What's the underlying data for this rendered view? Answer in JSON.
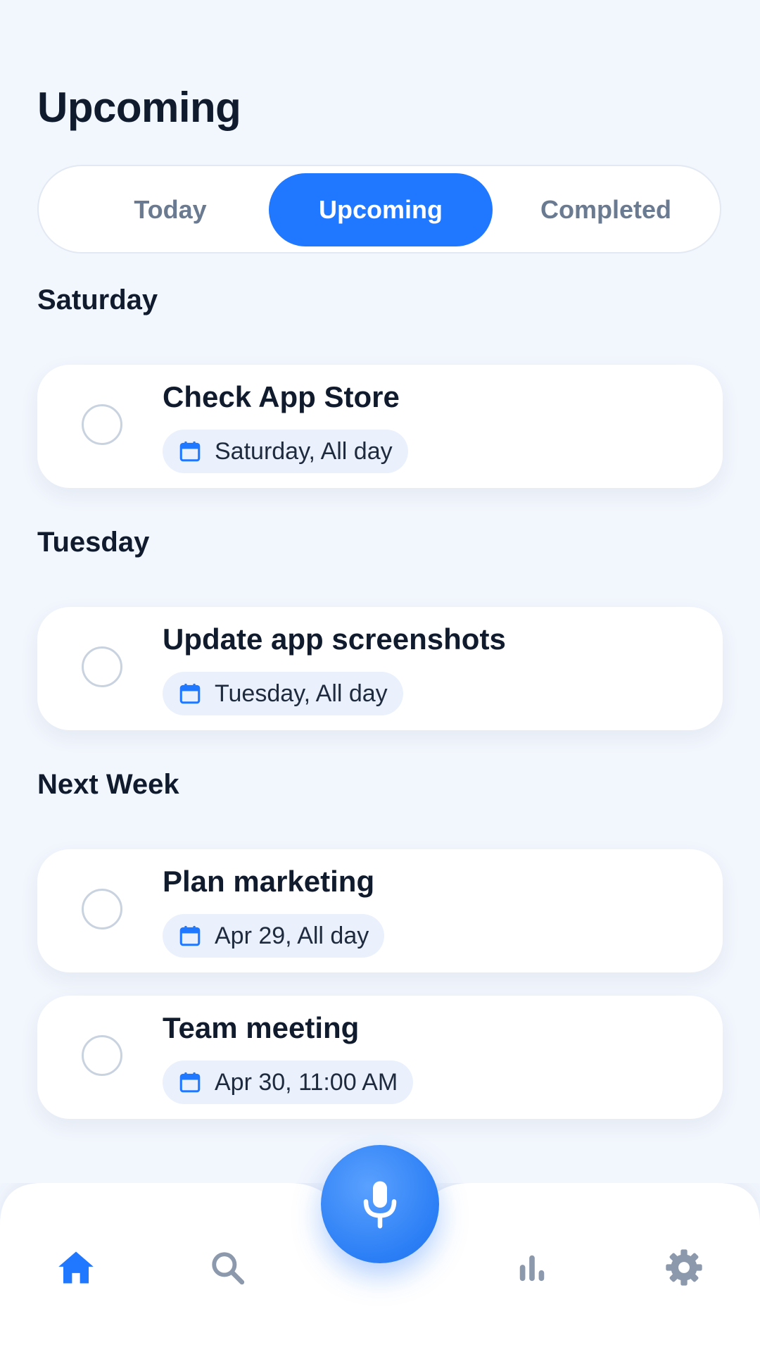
{
  "header": {
    "title": "Upcoming"
  },
  "tabs": [
    {
      "label": "Today",
      "active": false
    },
    {
      "label": "Upcoming",
      "active": true
    },
    {
      "label": "Completed",
      "active": false
    }
  ],
  "sections": [
    {
      "heading": "Saturday",
      "tasks": [
        {
          "title": "Check App Store",
          "date": "Saturday, All day",
          "icon": "calendar-icon",
          "completed": false
        }
      ]
    },
    {
      "heading": "Tuesday",
      "tasks": [
        {
          "title": "Update app screenshots",
          "date": "Tuesday, All day",
          "icon": "calendar-icon",
          "completed": false
        }
      ]
    },
    {
      "heading": "Next Week",
      "tasks": [
        {
          "title": "Plan marketing",
          "date": "Apr 29, All day",
          "icon": "calendar-icon",
          "completed": false
        },
        {
          "title": "Team meeting",
          "date": "Apr 30, 11:00 AM",
          "icon": "calendar-icon",
          "completed": false
        }
      ]
    }
  ],
  "bottom_nav": {
    "items": [
      {
        "icon": "home-icon",
        "active": true
      },
      {
        "icon": "search-icon",
        "active": false
      },
      {
        "icon": "microphone-icon",
        "active": false
      },
      {
        "icon": "bar-chart-icon",
        "active": false
      },
      {
        "icon": "gear-icon",
        "active": false
      }
    ]
  },
  "colors": {
    "accent": "#1f78ff",
    "background": "#f2f6fd",
    "card": "#ffffff",
    "text_primary": "#111b2e",
    "text_muted": "#6a7a91",
    "chip_background": "#eaf1fc",
    "nav_inactive": "#8c99ad"
  }
}
